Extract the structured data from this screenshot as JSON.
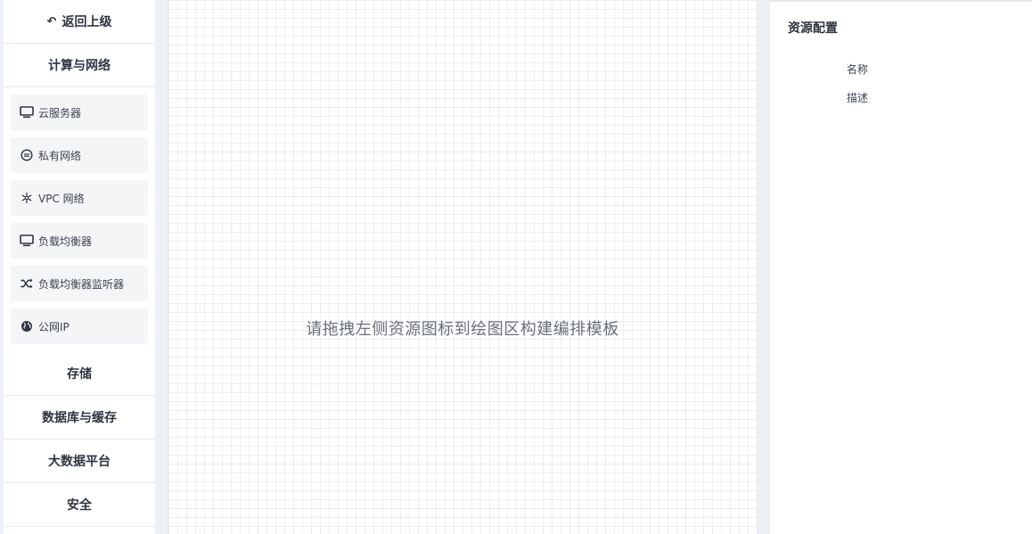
{
  "sidebar": {
    "back_label": "返回上级",
    "sections": [
      {
        "label": "计算与网络"
      },
      {
        "label": "存储"
      },
      {
        "label": "数据库与缓存"
      },
      {
        "label": "大数据平台"
      },
      {
        "label": "安全"
      }
    ],
    "items": [
      {
        "label": "云服务器",
        "icon": "monitor-icon"
      },
      {
        "label": "私有网络",
        "icon": "circle-minus-icon"
      },
      {
        "label": "VPC 网络",
        "icon": "snowflake-icon"
      },
      {
        "label": "负载均衡器",
        "icon": "monitor-icon"
      },
      {
        "label": "负载均衡器监听器",
        "icon": "shuffle-icon"
      },
      {
        "label": "公网IP",
        "icon": "globe-icon"
      }
    ]
  },
  "canvas": {
    "hint": "请拖拽左侧资源图标到绘图区构建编排模板"
  },
  "panel": {
    "title": "资源配置",
    "fields": [
      {
        "label": "名称"
      },
      {
        "label": "描述"
      }
    ]
  },
  "colors": {
    "page_bg": "#edf0f4",
    "text_primary": "#2f3542",
    "item_bg": "#f4f5f7",
    "grid_line": "#eceef1"
  }
}
